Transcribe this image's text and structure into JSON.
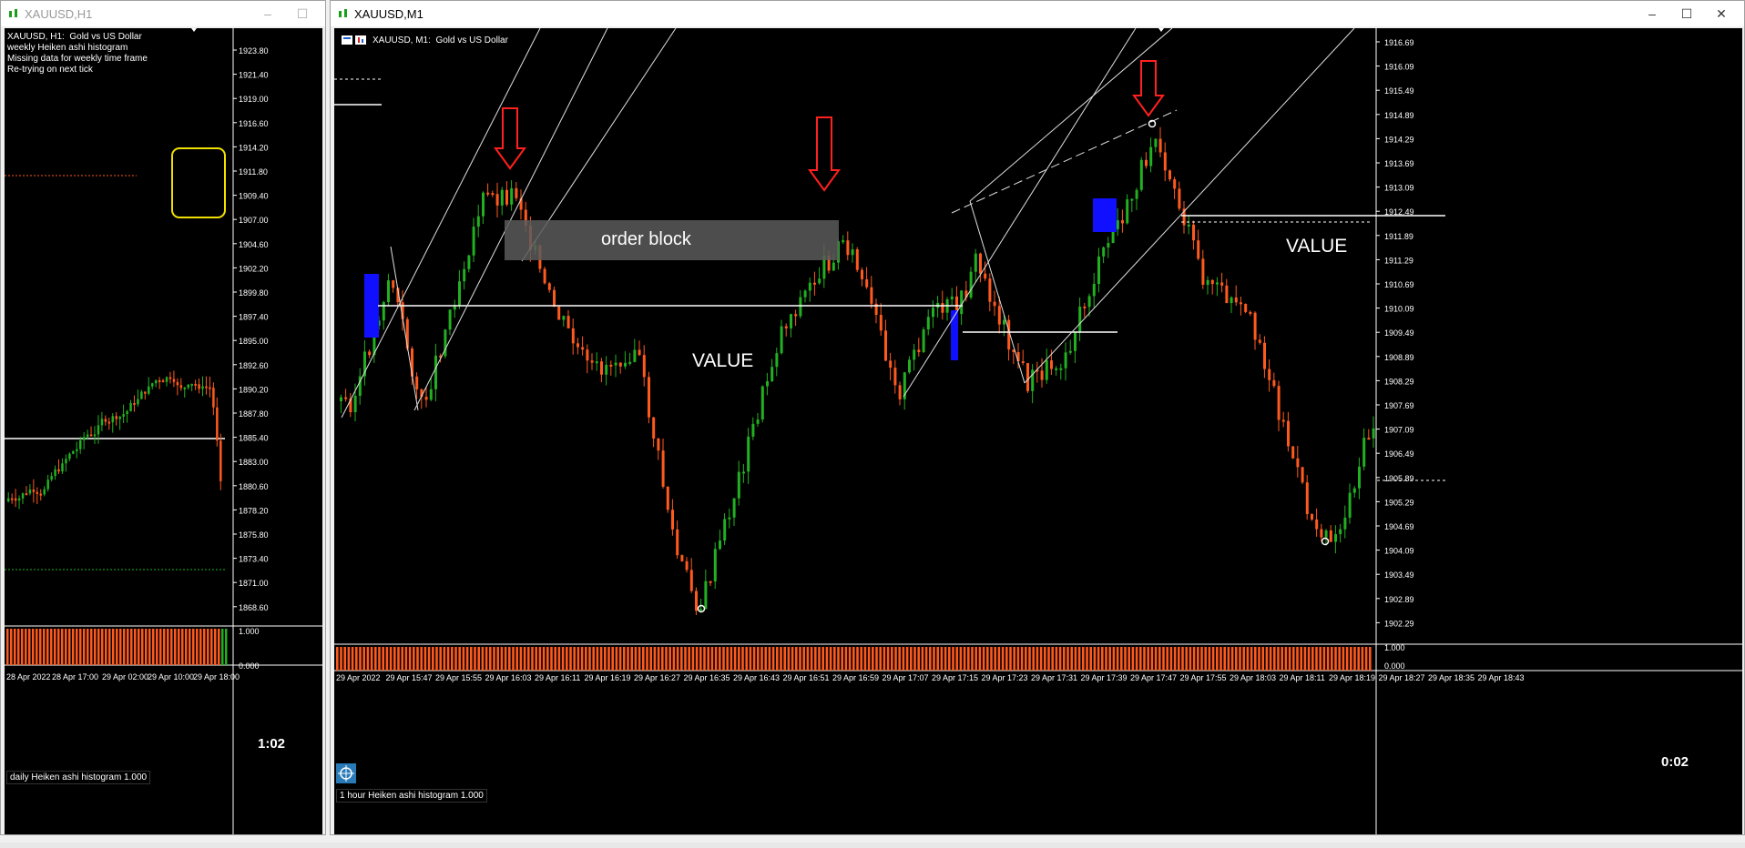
{
  "left_window": {
    "title": "XAUUSD,H1",
    "info_lines": [
      "XAUUSD, H1:  Gold vs US Dollar",
      "weekly Heiken ashi histogram",
      "Missing data for weekly time frame",
      "Re-trying on next tick"
    ],
    "countdown": "1:02",
    "indicator_label": "daily Heiken ashi histogram 1.000",
    "price_axis": [
      "1923.80",
      "1921.40",
      "1919.00",
      "1916.60",
      "1914.20",
      "1911.80",
      "1909.40",
      "1907.00",
      "1904.60",
      "1902.20",
      "1899.80",
      "1897.40",
      "1895.00",
      "1892.60",
      "1890.20",
      "1887.80",
      "1885.40",
      "1883.00",
      "1880.60",
      "1878.20",
      "1875.80",
      "1873.40",
      "1871.00",
      "1868.60"
    ],
    "indicator_axis": [
      "1.000",
      "0.000"
    ],
    "time_axis": [
      "28 Apr 2022",
      "28 Apr 17:00",
      "29 Apr 02:00",
      "29 Apr 10:00",
      "29 Apr 18:00"
    ]
  },
  "right_window": {
    "title": "XAUUSD,M1",
    "chart_header": "XAUUSD, M1:  Gold vs US Dollar",
    "countdown": "0:02",
    "indicator_label": "1 hour Heiken ashi histogram 1.000",
    "order_block_label": "order block",
    "value_label_1": "VALUE",
    "value_label_2": "VALUE",
    "price_axis": [
      "1916.69",
      "1916.09",
      "1915.49",
      "1914.89",
      "1914.29",
      "1913.69",
      "1913.09",
      "1912.49",
      "1911.89",
      "1911.29",
      "1910.69",
      "1910.09",
      "1909.49",
      "1908.89",
      "1908.29",
      "1907.69",
      "1907.09",
      "1906.49",
      "1905.89",
      "1905.29",
      "1904.69",
      "1904.09",
      "1903.49",
      "1902.89",
      "1902.29"
    ],
    "indicator_axis": [
      "1.000",
      "0.000"
    ],
    "time_axis": [
      "29 Apr 2022",
      "29 Apr 15:47",
      "29 Apr 15:55",
      "29 Apr 16:03",
      "29 Apr 16:11",
      "29 Apr 16:19",
      "29 Apr 16:27",
      "29 Apr 16:35",
      "29 Apr 16:43",
      "29 Apr 16:51",
      "29 Apr 16:59",
      "29 Apr 17:07",
      "29 Apr 17:15",
      "29 Apr 17:23",
      "29 Apr 17:31",
      "29 Apr 17:39",
      "29 Apr 17:47",
      "29 Apr 17:55",
      "29 Apr 18:03",
      "29 Apr 18:11",
      "29 Apr 18:19",
      "29 Apr 18:27",
      "29 Apr 18:35",
      "29 Apr 18:43"
    ]
  },
  "colors": {
    "bull": "#22b022",
    "bear": "#ff5a1e",
    "highlight": "#f0e000",
    "arrow": "#ff2020",
    "zone": "#1010ff"
  }
}
